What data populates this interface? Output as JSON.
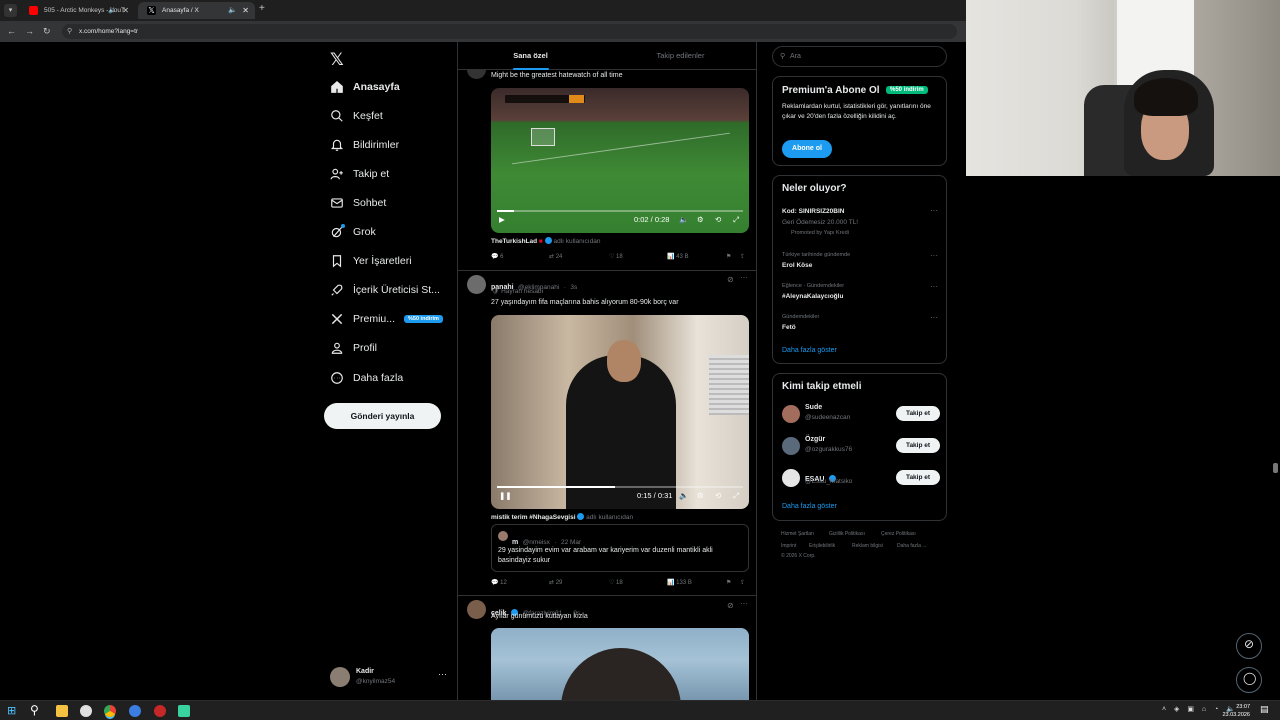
{
  "browser": {
    "tabs": [
      {
        "title": "505 - Arctic Monkeys - YouT",
        "active": false
      },
      {
        "title": "Anasayfa / X",
        "active": true
      }
    ],
    "url": "x.com/home?lang=tr"
  },
  "nav": {
    "items": [
      {
        "label": "Anasayfa",
        "icon": "home-icon"
      },
      {
        "label": "Keşfet",
        "icon": "search-icon"
      },
      {
        "label": "Bildirimler",
        "icon": "bell-icon"
      },
      {
        "label": "Takip et",
        "icon": "follow-icon"
      },
      {
        "label": "Sohbet",
        "icon": "mail-icon"
      },
      {
        "label": "Grok",
        "icon": "grok-icon"
      },
      {
        "label": "Yer İşaretleri",
        "icon": "bookmark-icon"
      },
      {
        "label": "İçerik Üreticisi St...",
        "icon": "rocket-icon"
      },
      {
        "label": "Premiu...",
        "icon": "x-logo-icon"
      },
      {
        "label": "Profil",
        "icon": "person-icon"
      },
      {
        "label": "Daha fazla",
        "icon": "more-circle-icon"
      }
    ],
    "premium_badge": "%50 indirim",
    "post_button": "Gönderi yayınla",
    "account": {
      "name": "Kadir",
      "handle": "@knyilmaz54"
    }
  },
  "feed": {
    "tabs": [
      "Sana özel",
      "Takip edilenler"
    ],
    "tweet1": {
      "text": "Might be the greatest hatewatch of all time",
      "video_time": "0:02 / 0:28",
      "attribution_user": "TheTurkishLad",
      "attribution_suffix": "adlı kullanıcıdan",
      "replies": "6",
      "reposts": "24",
      "likes": "18",
      "views": "43 B"
    },
    "tweet2": {
      "name": "panahi",
      "handle": "@eklimpanahi",
      "time": "3s",
      "context": "Hayran hesabı",
      "text": "27 yaşındayım fifa maçlarına bahis alıyorum 80-90k borç var",
      "video_time": "0:15 / 0:31",
      "attribution_user": "mistik terim #NhagaSevgisi",
      "attribution_suffix": "adlı kullanıcıdan",
      "quote": {
        "name": "m",
        "handle": "@nmeisx",
        "date": "22 Mar",
        "text": "29 yasindayim evim var arabam var kariyerim var duzenli mantikli akli basindayiz sukur"
      },
      "replies": "12",
      "reposts": "29",
      "likes": "18",
      "views": "133 B"
    },
    "tweet3": {
      "name": "çelik",
      "handle": "@farazlyim31",
      "time": "9s",
      "text": "Ayılar günümüzü kutlayan kızla"
    }
  },
  "sidebar": {
    "search_placeholder": "Ara",
    "premium": {
      "title": "Premium'a Abone Ol",
      "badge": "%50 indirim",
      "body": "Reklamlardan kurtul, istatistikleri gör, yanıtlarını öne çıkar ve 20'den fazla özelliğin kilidini aç.",
      "button": "Abone ol"
    },
    "trends": {
      "title": "Neler oluyor?",
      "items": [
        {
          "name": "Kod: SINIRSIZ20BIN",
          "meta": "Geri Ödemesiz 20.000 TL!",
          "promo": "Promoted by Yapı Kredi"
        },
        {
          "meta": "Türkiye tarihinde gündemde",
          "name": "Erol Köse"
        },
        {
          "meta": "Eğlence · Gündemdekiler",
          "name": "#AleynaKalaycıoğlu"
        },
        {
          "meta": "Gündemdekiler",
          "name": "Fetö"
        }
      ],
      "more": "Daha fazla göster"
    },
    "who_to_follow": {
      "title": "Kimi takip etmeli",
      "users": [
        {
          "name": "Sude",
          "handle": "@sudeenazcan"
        },
        {
          "name": "Özgür",
          "handle": "@ozgurakkus76"
        },
        {
          "name": "ESAU",
          "handle": "@Esau_Matsiko"
        }
      ],
      "button": "Takip et",
      "more": "Daha fazla göster"
    },
    "footer": [
      "Hizmet Şartları",
      "Gizlilik Politikası",
      "Çerez Politikası",
      "Imprint",
      "Erişilebilirlik",
      "Reklam bilgisi",
      "Daha fazla ...",
      "© 2026 X Corp."
    ]
  },
  "taskbar": {
    "time": "23:07",
    "date": "23.03.2026"
  },
  "colors": {
    "accent": "#1d9bf0",
    "premium_badge": "#00ba7c",
    "border": "#2f3336"
  }
}
